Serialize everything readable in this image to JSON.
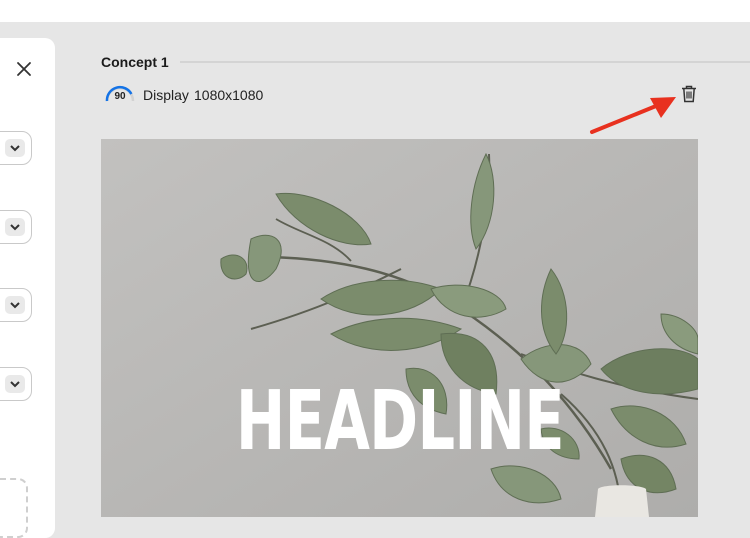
{
  "concept": {
    "title": "Concept 1",
    "score": "90",
    "score_color": "#1473e6",
    "type": "Display",
    "size": "1080x1080"
  },
  "creative": {
    "headline": "HEADLINE"
  },
  "icons": {
    "close": "close-icon",
    "chevron": "chevron-down-icon",
    "delete": "trash-icon",
    "annotation": "red-arrow"
  },
  "colors": {
    "arrow": "#e8311f",
    "leaf": "#7a8c6e",
    "background": "#e6e6e6"
  }
}
